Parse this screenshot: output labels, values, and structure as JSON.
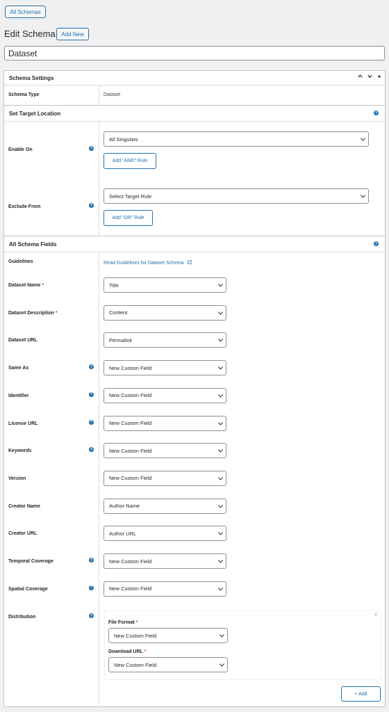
{
  "top": {
    "all_schemas": "All Schemas",
    "page_title": "Edit Schema",
    "add_new": "Add New",
    "schema_title": "Dataset"
  },
  "settings": {
    "header": "Schema Settings",
    "schema_type_label": "Schema Type",
    "schema_type_value": "Dataset"
  },
  "target": {
    "header": "Set Target Location",
    "enable_on_label": "Enable On",
    "enable_on_value": "All Singulars",
    "add_and_rule": "Add \"AND\" Rule",
    "exclude_from_label": "Exclude From",
    "exclude_from_value": "Select Target Rule",
    "add_or_rule": "Add \"OR\" Rule"
  },
  "fields": {
    "header": "All Schema Fields",
    "guidelines_label": "Guidelines",
    "guidelines_link": "Read Guidelines for Dataset Schema",
    "rows": [
      {
        "label": "Dataset Name",
        "required": "*",
        "value": "Title"
      },
      {
        "label": "Dataset Description",
        "required": "*",
        "value": "Content"
      },
      {
        "label": "Dataset URL",
        "value": "Permalink"
      },
      {
        "label": "Same As",
        "value": "New Custom Field"
      },
      {
        "label": "Identifier",
        "value": "New Custom Field"
      },
      {
        "label": "License URL",
        "value": "New Custom Field"
      },
      {
        "label": "Keywords",
        "value": "New Custom Field"
      },
      {
        "label": "Version",
        "value": "New Custom Field"
      },
      {
        "label": "Creator Name",
        "value": "Author Name"
      },
      {
        "label": "Creator URL",
        "value": "Author URL"
      },
      {
        "label": "Temporal Coverage",
        "value": "New Custom Field"
      },
      {
        "label": "Spatial Coverage",
        "value": "New Custom Field"
      }
    ],
    "distribution": {
      "label": "Distribution",
      "file_format_label": "File Format",
      "file_format_required": "*",
      "file_format_value": "New Custom Field",
      "download_url_label": "Download URL",
      "download_url_required": "*",
      "download_url_value": "New Custom Field",
      "add_button": "+ Add"
    }
  },
  "icons": {
    "help": "help-icon",
    "external": "external-link-icon",
    "chevron": "chevron-down-icon",
    "close": "close-icon"
  },
  "colors": {
    "accent": "#2271b1",
    "required": "#d63638",
    "background": "#f0f0f1",
    "border": "#c3c4c7"
  }
}
